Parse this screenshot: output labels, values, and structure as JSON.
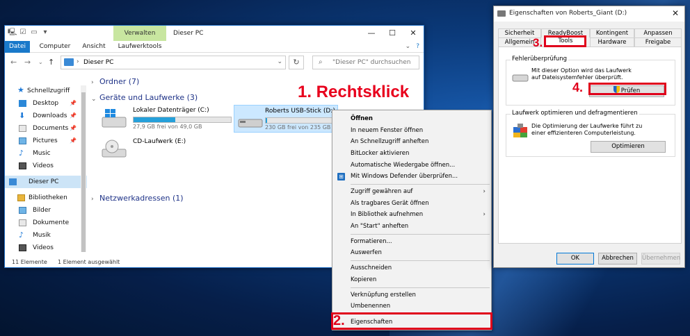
{
  "explorer": {
    "title": "Dieser PC",
    "context_tab": "Verwalten",
    "ribbon_tabs": [
      "Datei",
      "Computer",
      "Ansicht",
      "Laufwerktools"
    ],
    "address_path": "Dieser PC",
    "search_placeholder": "\"Dieser PC\" durchsuchen",
    "sidebar": [
      {
        "label": "Schnellzugriff",
        "pinned": false
      },
      {
        "label": "Desktop",
        "pinned": true
      },
      {
        "label": "Downloads",
        "pinned": true
      },
      {
        "label": "Documents",
        "pinned": true
      },
      {
        "label": "Pictures",
        "pinned": true
      },
      {
        "label": "Music",
        "pinned": false
      },
      {
        "label": "Videos",
        "pinned": false
      },
      {
        "label": "Dieser PC",
        "pinned": false
      },
      {
        "label": "Bibliotheken",
        "pinned": false
      },
      {
        "label": "Bilder",
        "pinned": false
      },
      {
        "label": "Dokumente",
        "pinned": false
      },
      {
        "label": "Musik",
        "pinned": false
      },
      {
        "label": "Videos",
        "pinned": false
      }
    ],
    "groups": {
      "folders": "Ordner (7)",
      "drives": "Geräte und Laufwerke (3)",
      "network": "Netzwerkadressen (1)"
    },
    "drives": [
      {
        "name": "Lokaler Datenträger (C:)",
        "free_text": "27,9 GB frei von 49,0 GB",
        "used_fraction": 0.43
      },
      {
        "name": "Roberts USB-Stick (D:)",
        "free_text": "230 GB frei von 235 GB",
        "used_fraction": 0.02
      },
      {
        "name": "CD-Laufwerk (E:)"
      }
    ],
    "status": {
      "items": "11 Elemente",
      "selected": "1 Element ausgewählt"
    }
  },
  "annotations": {
    "step1": "1. Rechtsklick",
    "step2": "2.",
    "step3": "3.",
    "step4": "4.",
    "accent_color": "#e0001b"
  },
  "context_menu": {
    "items": [
      {
        "label": "Öffnen",
        "bold": true
      },
      {
        "label": "In neuem Fenster öffnen"
      },
      {
        "label": "An Schnellzugriff anheften"
      },
      {
        "label": "BitLocker aktivieren"
      },
      {
        "label": "Automatische Wiedergabe öffnen..."
      },
      {
        "label": "Mit Windows Defender überprüfen...",
        "icon": "windows-defender-icon"
      },
      {
        "label": "Zugriff gewähren auf",
        "submenu": true
      },
      {
        "label": "Als tragbares Gerät öffnen"
      },
      {
        "label": "In Bibliothek aufnehmen",
        "submenu": true
      },
      {
        "label": "An \"Start\" anheften"
      },
      {
        "label": "Formatieren..."
      },
      {
        "label": "Auswerfen"
      },
      {
        "label": "Ausschneiden"
      },
      {
        "label": "Kopieren"
      },
      {
        "label": "Verknüpfung erstellen"
      },
      {
        "label": "Umbenennen"
      },
      {
        "label": "Eigenschaften"
      }
    ]
  },
  "properties": {
    "title": "Eigenschaften von Roberts_Giant (D:)",
    "tabs_row1": [
      "Sicherheit",
      "ReadyBoost",
      "Kontingent",
      "Anpassen"
    ],
    "tabs_row2": [
      "Allgemein",
      "Tools",
      "Hardware",
      "Freigabe"
    ],
    "error_check": {
      "title": "Fehlerüberprüfung",
      "text": "Mit dieser Option wird das Laufwerk auf Dateisystemfehler überprüft.",
      "button": "Prüfen"
    },
    "optimize": {
      "title": "Laufwerk optimieren und defragmentieren",
      "text": "Die Optimierung der Laufwerke führt zu einer effizienteren Computerleistung.",
      "button": "Optimieren"
    },
    "buttons": {
      "ok": "OK",
      "cancel": "Abbrechen",
      "apply": "Übernehmen"
    }
  }
}
